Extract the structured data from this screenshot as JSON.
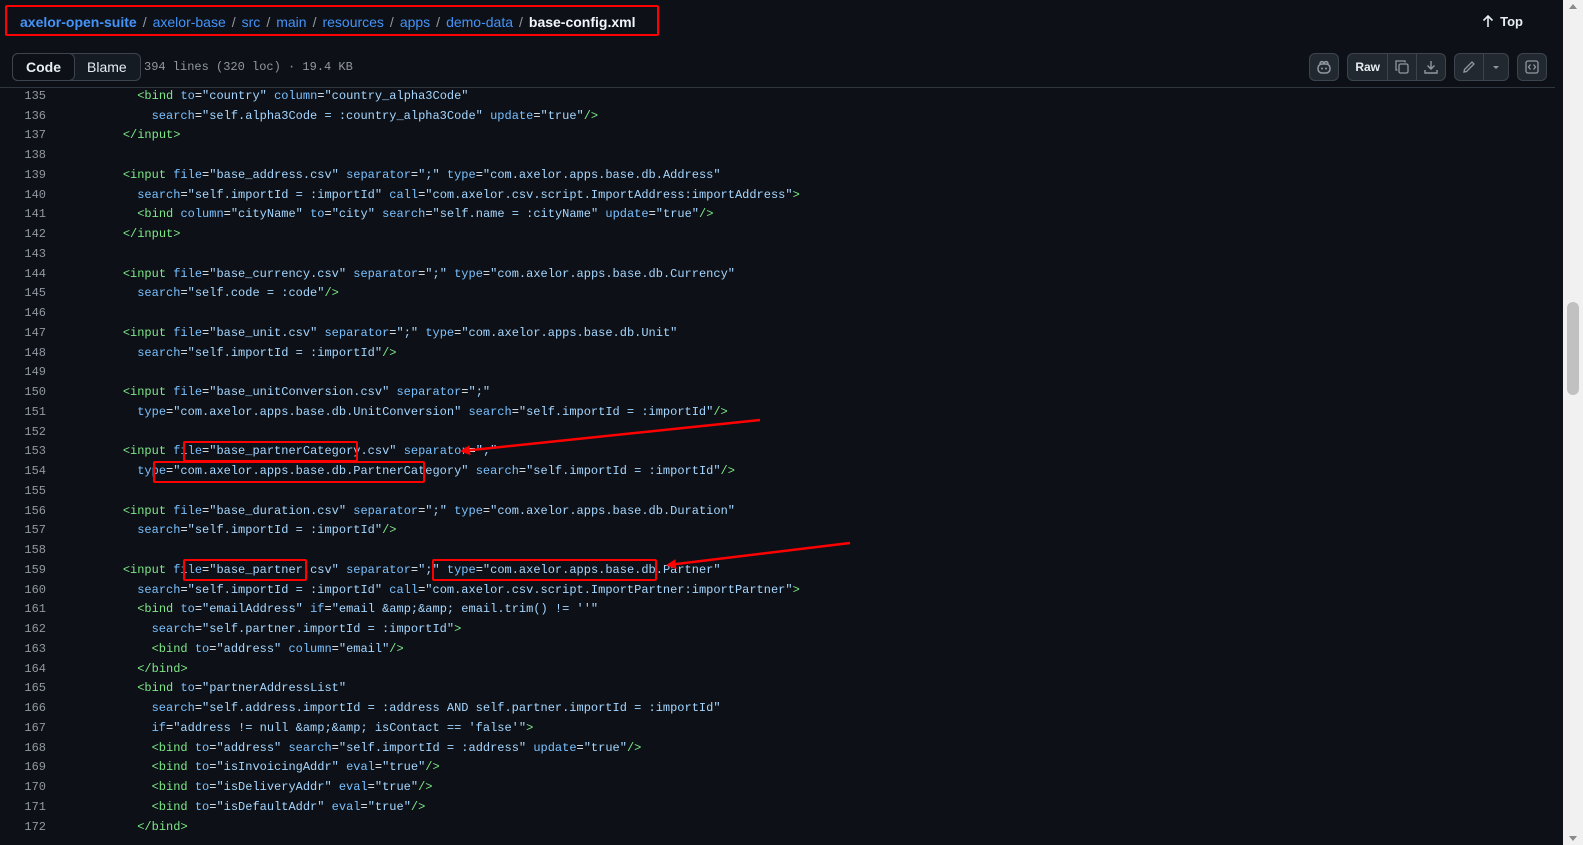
{
  "breadcrumb": {
    "parts": [
      "axelor-open-suite",
      "axelor-base",
      "src",
      "main",
      "resources",
      "apps",
      "demo-data"
    ],
    "file": "base-config.xml"
  },
  "top_link": "Top",
  "toolbar": {
    "tab_code": "Code",
    "tab_blame": "Blame",
    "file_info": "394 lines (320 loc) · 19.4 KB",
    "raw_label": "Raw"
  },
  "icons": {
    "top": "arrow-up-icon",
    "copilot": "copilot-icon",
    "copy": "copy-icon",
    "download": "download-icon",
    "edit": "pencil-icon",
    "dropdown": "triangle-down-icon",
    "symbols": "code-square-icon"
  },
  "colors": {
    "background": "#0d1117",
    "link": "#4493f8",
    "tag": "#7ee787",
    "attr": "#79c0ff",
    "string": "#a5d6ff",
    "annotation": "#ff0000"
  },
  "code_lines": [
    {
      "n": "135",
      "text": "      <bind to=\"country\" column=\"country_alpha3Code\""
    },
    {
      "n": "136",
      "text": "        search=\"self.alpha3Code = :country_alpha3Code\" update=\"true\"/>"
    },
    {
      "n": "137",
      "text": "    </input>"
    },
    {
      "n": "138",
      "text": ""
    },
    {
      "n": "139",
      "text": "    <input file=\"base_address.csv\" separator=\";\" type=\"com.axelor.apps.base.db.Address\""
    },
    {
      "n": "140",
      "text": "      search=\"self.importId = :importId\" call=\"com.axelor.csv.script.ImportAddress:importAddress\">"
    },
    {
      "n": "141",
      "text": "      <bind column=\"cityName\" to=\"city\" search=\"self.name = :cityName\" update=\"true\"/>"
    },
    {
      "n": "142",
      "text": "    </input>"
    },
    {
      "n": "143",
      "text": ""
    },
    {
      "n": "144",
      "text": "    <input file=\"base_currency.csv\" separator=\";\" type=\"com.axelor.apps.base.db.Currency\""
    },
    {
      "n": "145",
      "text": "      search=\"self.code = :code\"/>"
    },
    {
      "n": "146",
      "text": ""
    },
    {
      "n": "147",
      "text": "    <input file=\"base_unit.csv\" separator=\";\" type=\"com.axelor.apps.base.db.Unit\""
    },
    {
      "n": "148",
      "text": "      search=\"self.importId = :importId\"/>"
    },
    {
      "n": "149",
      "text": ""
    },
    {
      "n": "150",
      "text": "    <input file=\"base_unitConversion.csv\" separator=\";\""
    },
    {
      "n": "151",
      "text": "      type=\"com.axelor.apps.base.db.UnitConversion\" search=\"self.importId = :importId\"/>"
    },
    {
      "n": "152",
      "text": ""
    },
    {
      "n": "153",
      "text": "    <input file=\"base_partnerCategory.csv\" separator=\";\""
    },
    {
      "n": "154",
      "text": "      type=\"com.axelor.apps.base.db.PartnerCategory\" search=\"self.importId = :importId\"/>"
    },
    {
      "n": "155",
      "text": ""
    },
    {
      "n": "156",
      "text": "    <input file=\"base_duration.csv\" separator=\";\" type=\"com.axelor.apps.base.db.Duration\""
    },
    {
      "n": "157",
      "text": "      search=\"self.importId = :importId\"/>"
    },
    {
      "n": "158",
      "text": ""
    },
    {
      "n": "159",
      "text": "    <input file=\"base_partner.csv\" separator=\";\" type=\"com.axelor.apps.base.db.Partner\""
    },
    {
      "n": "160",
      "text": "      search=\"self.importId = :importId\" call=\"com.axelor.csv.script.ImportPartner:importPartner\">"
    },
    {
      "n": "161",
      "text": "      <bind to=\"emailAddress\" if=\"email &amp;&amp; email.trim() != ''\""
    },
    {
      "n": "162",
      "text": "        search=\"self.partner.importId = :importId\">"
    },
    {
      "n": "163",
      "text": "        <bind to=\"address\" column=\"email\"/>"
    },
    {
      "n": "164",
      "text": "      </bind>"
    },
    {
      "n": "165",
      "text": "      <bind to=\"partnerAddressList\""
    },
    {
      "n": "166",
      "text": "        search=\"self.address.importId = :address AND self.partner.importId = :importId\""
    },
    {
      "n": "167",
      "text": "        if=\"address != null &amp;&amp; isContact == 'false'\">"
    },
    {
      "n": "168",
      "text": "        <bind to=\"address\" search=\"self.importId = :address\" update=\"true\"/>"
    },
    {
      "n": "169",
      "text": "        <bind to=\"isInvoicingAddr\" eval=\"true\"/>"
    },
    {
      "n": "170",
      "text": "        <bind to=\"isDeliveryAddr\" eval=\"true\"/>"
    },
    {
      "n": "171",
      "text": "        <bind to=\"isDefaultAddr\" eval=\"true\"/>"
    },
    {
      "n": "172",
      "text": "      </bind>"
    }
  ]
}
